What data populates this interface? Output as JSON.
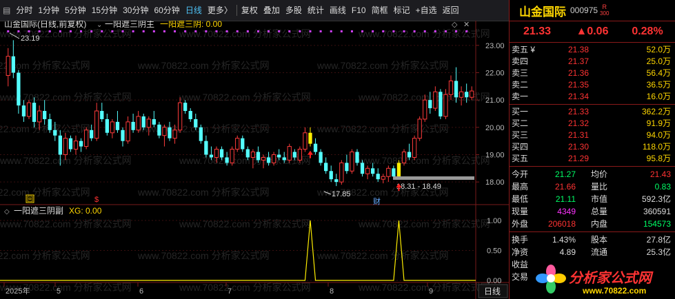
{
  "toolbar": {
    "left_items": [
      "分时",
      "1分钟",
      "5分钟",
      "15分钟",
      "30分钟",
      "60分钟",
      "日线",
      "更多〉"
    ],
    "active": "日线",
    "right_items": [
      "复权",
      "叠加",
      "多股",
      "统计",
      "画线",
      "F10",
      "简框",
      "标记",
      "+自选",
      "返回"
    ]
  },
  "main_chart": {
    "title": "山金国际(日线,前复权)",
    "indicator_name": "一阳遮三阴主",
    "indicator_value_label": "一阳遮三阴: 0.00",
    "y_ticks": [
      "23.00",
      "22.00",
      "21.00",
      "20.00",
      "19.00",
      "18.00"
    ],
    "annotations": {
      "high": "23.19",
      "low": "17.85",
      "range": "18.31 - 18.49"
    },
    "markers": {
      "box": "回",
      "dollar": "$",
      "cai": "财"
    }
  },
  "sub_chart": {
    "title": "一阳遮三阴副",
    "value_label": "XG: 0.00",
    "y_ticks": [
      "1.00",
      "0.50",
      "0.00"
    ]
  },
  "x_axis": {
    "labels": [
      "2025年",
      "5",
      "6",
      "7",
      "8",
      "9"
    ],
    "period_button": "日线"
  },
  "watermark": "www.70822.com 分析家公式网",
  "chart_data": {
    "type": "candlestick",
    "y_range": [
      17.6,
      23.4
    ],
    "candles": [
      [
        21.9,
        22.9,
        21.5,
        22.6
      ],
      [
        22.6,
        23.19,
        21.8,
        22.0
      ],
      [
        22.0,
        22.1,
        20.5,
        20.8
      ],
      [
        20.8,
        21.0,
        20.2,
        20.4
      ],
      [
        20.4,
        21.0,
        20.3,
        20.9
      ],
      [
        20.9,
        21.1,
        20.0,
        20.2
      ],
      [
        20.2,
        20.8,
        19.9,
        20.6
      ],
      [
        20.6,
        21.0,
        20.1,
        20.3
      ],
      [
        20.3,
        20.5,
        19.8,
        19.9
      ],
      [
        19.9,
        20.2,
        19.5,
        19.7
      ],
      [
        19.7,
        19.9,
        18.6,
        19.0
      ],
      [
        19.0,
        19.8,
        18.8,
        19.6
      ],
      [
        19.6,
        19.7,
        19.1,
        19.2
      ],
      [
        19.2,
        19.7,
        19.0,
        19.5
      ],
      [
        19.5,
        19.6,
        19.1,
        19.3
      ],
      [
        19.3,
        20.0,
        19.2,
        19.9
      ],
      [
        19.9,
        20.1,
        19.5,
        19.6
      ],
      [
        19.6,
        20.9,
        19.5,
        20.6
      ],
      [
        20.6,
        20.9,
        20.2,
        20.3
      ],
      [
        20.3,
        20.5,
        19.7,
        19.8
      ],
      [
        19.8,
        20.3,
        19.6,
        20.2
      ],
      [
        20.2,
        20.6,
        19.8,
        19.9
      ],
      [
        19.9,
        20.0,
        19.3,
        19.5
      ],
      [
        19.5,
        20.4,
        19.4,
        20.2
      ],
      [
        20.2,
        20.5,
        19.8,
        19.9
      ],
      [
        19.9,
        20.6,
        19.8,
        20.4
      ],
      [
        20.4,
        20.5,
        19.9,
        20.0
      ],
      [
        20.0,
        20.4,
        19.7,
        20.3
      ],
      [
        20.3,
        20.6,
        20.0,
        20.1
      ],
      [
        20.1,
        20.2,
        19.6,
        19.7
      ],
      [
        19.7,
        20.1,
        19.3,
        20.0
      ],
      [
        20.0,
        20.2,
        19.5,
        19.6
      ],
      [
        19.6,
        20.1,
        19.4,
        19.9
      ],
      [
        19.9,
        21.1,
        19.8,
        20.9
      ],
      [
        20.9,
        21.0,
        20.5,
        20.6
      ],
      [
        20.6,
        20.7,
        20.2,
        20.3
      ],
      [
        20.3,
        20.5,
        19.9,
        20.0
      ],
      [
        20.0,
        20.1,
        19.4,
        19.5
      ],
      [
        19.5,
        19.7,
        18.9,
        19.0
      ],
      [
        19.0,
        19.3,
        18.8,
        18.9
      ],
      [
        18.9,
        19.3,
        18.7,
        19.2
      ],
      [
        19.2,
        19.3,
        18.8,
        18.9
      ],
      [
        18.9,
        19.1,
        18.6,
        18.7
      ],
      [
        18.7,
        19.3,
        18.6,
        19.2
      ],
      [
        19.2,
        19.7,
        19.1,
        19.6
      ],
      [
        19.6,
        19.7,
        19.1,
        19.2
      ],
      [
        19.2,
        19.3,
        18.8,
        18.9
      ],
      [
        18.9,
        19.2,
        18.5,
        19.1
      ],
      [
        19.1,
        19.3,
        18.7,
        18.8
      ],
      [
        18.8,
        19.0,
        18.5,
        18.9
      ],
      [
        18.9,
        19.1,
        18.6,
        18.7
      ],
      [
        18.7,
        19.1,
        18.6,
        19.0
      ],
      [
        19.0,
        19.2,
        18.8,
        18.9
      ],
      [
        18.9,
        19.1,
        18.7,
        18.8
      ],
      [
        18.8,
        19.4,
        18.7,
        19.3
      ],
      [
        19.1,
        19.2,
        18.8,
        18.9
      ],
      [
        18.8,
        19.3,
        18.7,
        19.2
      ],
      [
        19.2,
        20.0,
        19.1,
        19.8
      ],
      [
        19.8,
        20.0,
        19.3,
        19.4
      ],
      [
        19.4,
        19.6,
        19.0,
        19.1
      ],
      [
        19.1,
        19.2,
        18.6,
        18.7
      ],
      [
        18.7,
        18.9,
        18.3,
        18.4
      ],
      [
        18.4,
        18.6,
        18.0,
        18.1
      ],
      [
        18.1,
        18.3,
        17.85,
        18.0
      ],
      [
        18.0,
        18.8,
        17.9,
        18.7
      ],
      [
        18.7,
        19.0,
        18.3,
        18.4
      ],
      [
        18.4,
        19.2,
        18.3,
        19.1
      ],
      [
        19.1,
        19.2,
        18.6,
        18.7
      ],
      [
        18.7,
        18.8,
        18.2,
        18.3
      ],
      [
        18.3,
        18.6,
        18.1,
        18.5
      ],
      [
        18.5,
        18.7,
        18.2,
        18.3
      ],
      [
        18.3,
        18.5,
        18.0,
        18.1
      ],
      [
        18.1,
        18.3,
        17.95,
        18.2
      ],
      [
        18.2,
        18.6,
        18.0,
        18.5
      ],
      [
        18.5,
        18.6,
        18.1,
        18.2
      ],
      [
        18.2,
        18.8,
        18.1,
        18.7
      ],
      [
        18.7,
        19.2,
        18.6,
        19.1
      ],
      [
        19.1,
        19.4,
        18.8,
        18.9
      ],
      [
        18.9,
        19.7,
        18.8,
        19.6
      ],
      [
        19.6,
        20.4,
        19.5,
        20.3
      ],
      [
        20.3,
        21.2,
        20.2,
        21.0
      ],
      [
        21.0,
        21.3,
        20.5,
        20.7
      ],
      [
        20.7,
        21.5,
        20.6,
        21.3
      ],
      [
        21.3,
        21.4,
        20.3,
        20.4
      ],
      [
        20.4,
        21.4,
        20.3,
        21.2
      ],
      [
        21.2,
        21.9,
        21.0,
        21.7
      ],
      [
        21.7,
        22.2,
        20.9,
        21.1
      ],
      [
        21.1,
        21.5,
        20.8,
        21.3
      ],
      [
        21.3,
        21.6,
        20.9,
        21.1
      ],
      [
        21.1,
        21.5,
        21.0,
        21.33
      ]
    ],
    "yellow_bar_indices": [
      58,
      75
    ],
    "xg_signal_indices": [
      58,
      75
    ]
  },
  "quote": {
    "name": "山金国际",
    "code": "000975",
    "mark_r": "R",
    "mark_num": "300",
    "price": "21.33",
    "change": "▲0.06",
    "change_pct": "0.28%",
    "asks": [
      {
        "label": "卖五 ¥",
        "price": "21.38",
        "vol": "52.0万"
      },
      {
        "label": "卖四",
        "price": "21.37",
        "vol": "25.0万"
      },
      {
        "label": "卖三",
        "price": "21.36",
        "vol": "56.4万"
      },
      {
        "label": "卖二",
        "price": "21.35",
        "vol": "36.5万"
      },
      {
        "label": "卖一",
        "price": "21.34",
        "vol": "16.0万"
      }
    ],
    "bids": [
      {
        "label": "买一",
        "price": "21.33",
        "vol": "362.2万"
      },
      {
        "label": "买二",
        "price": "21.32",
        "vol": "91.9万"
      },
      {
        "label": "买三",
        "price": "21.31",
        "vol": "94.0万"
      },
      {
        "label": "买四",
        "price": "21.30",
        "vol": "118.0万"
      },
      {
        "label": "买五",
        "price": "21.29",
        "vol": "95.8万"
      }
    ],
    "stats": [
      {
        "a": "今开",
        "b": "21.27",
        "bc": "green",
        "c": "均价",
        "d": "21.43",
        "dc": "red"
      },
      {
        "a": "最高",
        "b": "21.66",
        "bc": "red",
        "c": "量比",
        "d": "0.83",
        "dc": "green"
      },
      {
        "a": "最低",
        "b": "21.11",
        "bc": "green",
        "c": "市值",
        "d": "592.3亿",
        "dc": "white"
      },
      {
        "a": "现量",
        "b": "4349",
        "bc": "mag",
        "c": "总量",
        "d": "360591",
        "dc": "white"
      },
      {
        "a": "外盘",
        "b": "206018",
        "bc": "red",
        "c": "内盘",
        "d": "154573",
        "dc": "green"
      }
    ],
    "stats2": [
      {
        "a": "换手",
        "b": "1.43%",
        "bc": "white",
        "c": "股本",
        "d": "27.8亿",
        "dc": "white"
      },
      {
        "a": "净资",
        "b": "4.89",
        "bc": "white",
        "c": "流通",
        "d": "25.3亿",
        "dc": "white"
      },
      {
        "a": "收益",
        "b": "",
        "bc": "white",
        "c": "",
        "d": "",
        "dc": "white"
      },
      {
        "a": "交易",
        "b": "",
        "bc": "white",
        "c": "",
        "d": "",
        "dc": "white"
      }
    ]
  },
  "logo": {
    "text": "分析家公式网",
    "url": "www.70822.com"
  }
}
